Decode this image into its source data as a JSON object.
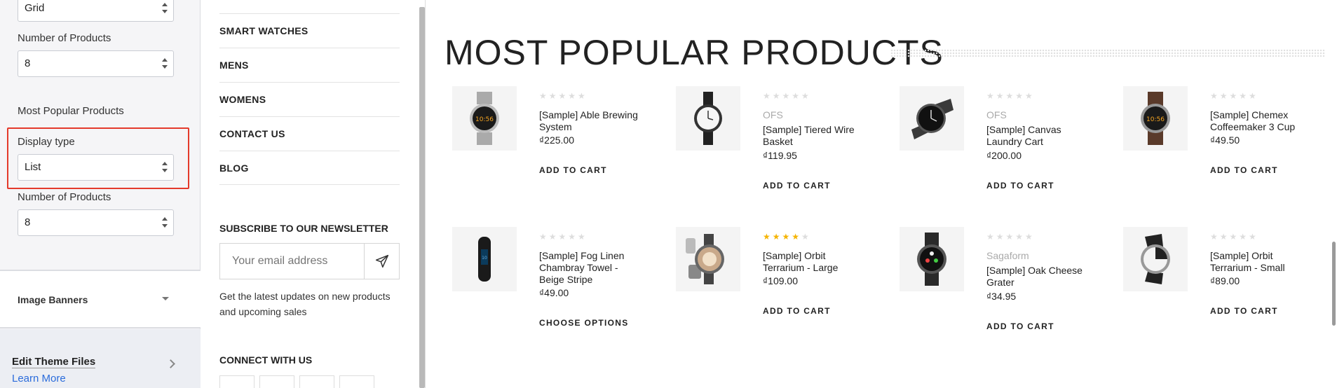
{
  "settings": {
    "top_select_value": "Grid",
    "num_products_label_1": "Number of Products",
    "num_products_value_1": "8",
    "section_title": "Most Popular Products",
    "display_type_label": "Display type",
    "display_type_value": "List",
    "num_products_label_2": "Number of Products",
    "num_products_value_2": "8",
    "image_banners_label": "Image Banners",
    "edit_theme_label": "Edit Theme Files",
    "learn_more_label": "Learn More"
  },
  "menu": {
    "items": [
      "SMART WATCHES",
      "MENS",
      "WOMENS",
      "CONTACT US",
      "BLOG"
    ],
    "newsletter_title": "SUBSCRIBE TO OUR NEWSLETTER",
    "email_placeholder": "Your email address",
    "newsletter_desc": "Get the latest updates on new products and upcoming sales",
    "connect_title": "CONNECT WITH US"
  },
  "main": {
    "heading": "MOST POPULAR PRODUCTS",
    "products": [
      {
        "brand": "",
        "name": "[Sample] Able Brewing System",
        "price": "₫225.00",
        "action": "ADD TO CART",
        "rating": 0,
        "icon": "watch-steel-icon"
      },
      {
        "brand": "OFS",
        "name": "[Sample] Tiered Wire Basket",
        "price": "₫119.95",
        "action": "ADD TO CART",
        "rating": 0,
        "icon": "watch-round-white-icon"
      },
      {
        "brand": "OFS",
        "name": "[Sample] Canvas Laundry Cart",
        "price": "₫200.00",
        "action": "ADD TO CART",
        "rating": 0,
        "icon": "watch-black-icon"
      },
      {
        "brand": "",
        "name": "[Sample] Chemex Coffeemaker 3 Cup",
        "price": "₫49.50",
        "action": "ADD TO CART",
        "rating": 0,
        "icon": "watch-leather-icon"
      },
      {
        "brand": "",
        "name": "[Sample] Fog Linen Chambray Towel - Beige Stripe",
        "price": "₫49.00",
        "action": "CHOOSE OPTIONS",
        "rating": 0,
        "icon": "fitness-band-icon"
      },
      {
        "brand": "",
        "name": "[Sample] Orbit Terrarium - Large",
        "price": "₫109.00",
        "action": "ADD TO CART",
        "rating": 4,
        "icon": "smartwatch-round-icon"
      },
      {
        "brand": "Sagaform",
        "name": "[Sample] Oak Cheese Grater",
        "price": "₫34.95",
        "action": "ADD TO CART",
        "rating": 0,
        "icon": "smartwatch-dark-icon"
      },
      {
        "brand": "",
        "name": "[Sample] Orbit Terrarium - Small",
        "price": "₫89.00",
        "action": "ADD TO CART",
        "rating": 0,
        "icon": "watch-white-dial-icon"
      }
    ],
    "colors": {
      "star_filled": "#f5b400",
      "star_empty": "#dddddd",
      "highlight": "#e43a2b",
      "link": "#2b6cdb"
    }
  }
}
